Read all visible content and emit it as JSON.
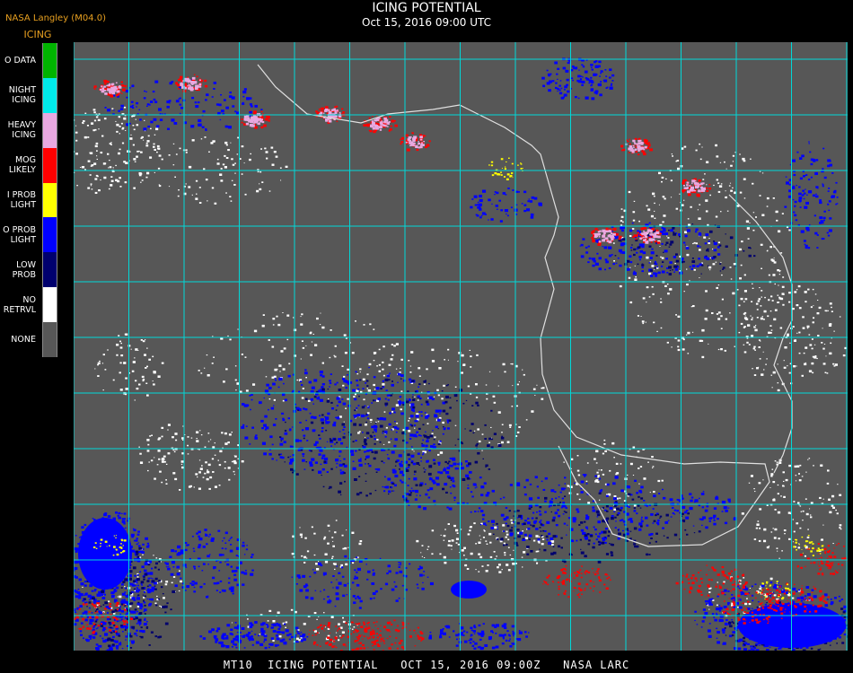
{
  "header": {
    "agency": "NASA Langley (M04.0)",
    "product": "ICING",
    "title": "ICING POTENTIAL",
    "subtitle": "Oct 15, 2016 09:00 UTC"
  },
  "legend": [
    {
      "label": "O DATA",
      "color": "#00b400"
    },
    {
      "label": "NIGHT\nICING",
      "color": "#00eaea"
    },
    {
      "label": "HEAVY\nICING",
      "color": "#e8a8e0"
    },
    {
      "label": "MOG\nLIKELY",
      "color": "#ff0000"
    },
    {
      "label": "I PROB\nLIGHT",
      "color": "#ffff00"
    },
    {
      "label": "O PROB\nLIGHT",
      "color": "#0000ff"
    },
    {
      "label": "LOW\nPROB",
      "color": "#00006e"
    },
    {
      "label": "NO\nRETRVL",
      "color": "#ffffff"
    },
    {
      "label": "NONE",
      "color": "#575757"
    }
  ],
  "footer": "MT10  ICING POTENTIAL   OCT 15, 2016 09:00Z   NASA LARC",
  "colors": {
    "grid": "#00d8d8",
    "coast": "#e0e0e0",
    "background": "#000000"
  }
}
